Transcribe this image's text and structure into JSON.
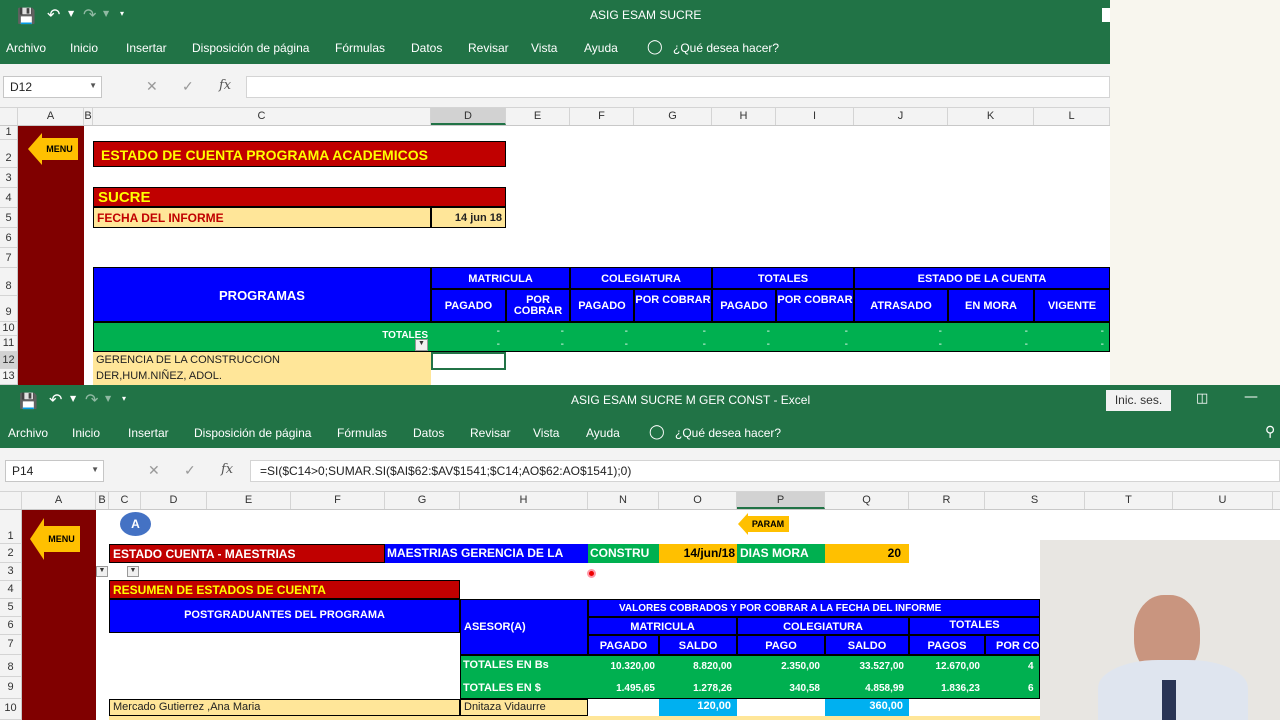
{
  "top": {
    "title": "ASIG ESAM SUCRE",
    "ribbon": [
      "Archivo",
      "Inicio",
      "Insertar",
      "Disposición de página",
      "Fórmulas",
      "Datos",
      "Revisar",
      "Vista",
      "Ayuda",
      "¿Qué desea hacer?"
    ],
    "namebox": "D12",
    "formula": "",
    "cols": [
      "A",
      "B",
      "C",
      "D",
      "E",
      "F",
      "G",
      "H",
      "I",
      "J",
      "K",
      "L"
    ],
    "rows": [
      "1",
      "2",
      "3",
      "4",
      "5",
      "6",
      "7",
      "8",
      "9",
      "10",
      "11",
      "12",
      "13"
    ],
    "menu_label": "MENU",
    "main_title": "ESTADO DE CUENTA PROGRAMA ACADEMICOS",
    "city": "SUCRE",
    "fecha_label": "FECHA DEL INFORME",
    "fecha_value": "14 jun 18",
    "programas": "PROGRAMAS",
    "groups": [
      "MATRICULA",
      "COLEGIATURA",
      "TOTALES",
      "ESTADO DE LA CUENTA"
    ],
    "subheads": [
      "PAGADO",
      "POR COBRAR",
      "PAGADO",
      "POR COBRAR",
      "PAGADO",
      "POR COBRAR",
      "ATRASADO",
      "EN MORA",
      "VIGENTE"
    ],
    "totales": "TOTALES",
    "dash": "-",
    "list": [
      "GERENCIA  DE LA CONSTRUCCION",
      "DER,HUM.NIÑEZ, ADOL."
    ]
  },
  "bottom": {
    "title": "ASIG ESAM SUCRE M GER CONST  -  Excel",
    "signin": "Inic. ses.",
    "ribbon": [
      "Archivo",
      "Inicio",
      "Insertar",
      "Disposición de página",
      "Fórmulas",
      "Datos",
      "Revisar",
      "Vista",
      "Ayuda",
      "¿Qué desea hacer?"
    ],
    "namebox": "P14",
    "formula": "=SI($C14>0;SUMAR.SI($AI$62:$AV$1541;$C14;AO$62:AO$1541);0)",
    "cols": [
      "A",
      "B",
      "C",
      "D",
      "E",
      "F",
      "G",
      "H",
      "N",
      "O",
      "P",
      "Q",
      "R",
      "S",
      "T",
      "U"
    ],
    "rows": [
      "1",
      "2",
      "3",
      "4",
      "5",
      "6",
      "7",
      "8",
      "9",
      "10"
    ],
    "circle": "A",
    "param": "PARAM",
    "menu_label": "MENU",
    "estado": "ESTADO CUENTA - MAESTRIAS",
    "maestrias": "MAESTRIAS  GERENCIA  DE LA",
    "construc": "CONSTRU",
    "date": "14/jun/18",
    "dias_mora": "DIAS MORA",
    "dias_value": "20",
    "resumen": "RESUMEN DE ESTADOS DE CUENTA",
    "postgrad": "POSTGRADUANTES DEL PROGRAMA",
    "asesor": "ASESOR(A)",
    "valores": "VALORES COBRADOS Y POR COBRAR A LA FECHA DEL INFORME",
    "matricula": "MATRICULA",
    "colegiatura": "COLEGIATURA",
    "totales": "TOTALES",
    "sub": [
      "PAGADO",
      "SALDO",
      "PAGO",
      "SALDO",
      "PAGOS",
      "POR CO"
    ],
    "tot_bs_label": "TOTALES EN  Bs",
    "tot_bs": [
      "10.320,00",
      "8.820,00",
      "2.350,00",
      "33.527,00",
      "12.670,00",
      "4"
    ],
    "tot_usd_label": "TOTALES EN  $",
    "tot_usd": [
      "1.495,65",
      "1.278,26",
      "340,58",
      "4.858,99",
      "1.836,23",
      "6"
    ],
    "row10_name": "Mercado Gutierrez ,Ana Maria",
    "row10_asesor": "Dnitaza Vidaurre",
    "row10_vals": [
      "120,00",
      "360,00"
    ]
  }
}
